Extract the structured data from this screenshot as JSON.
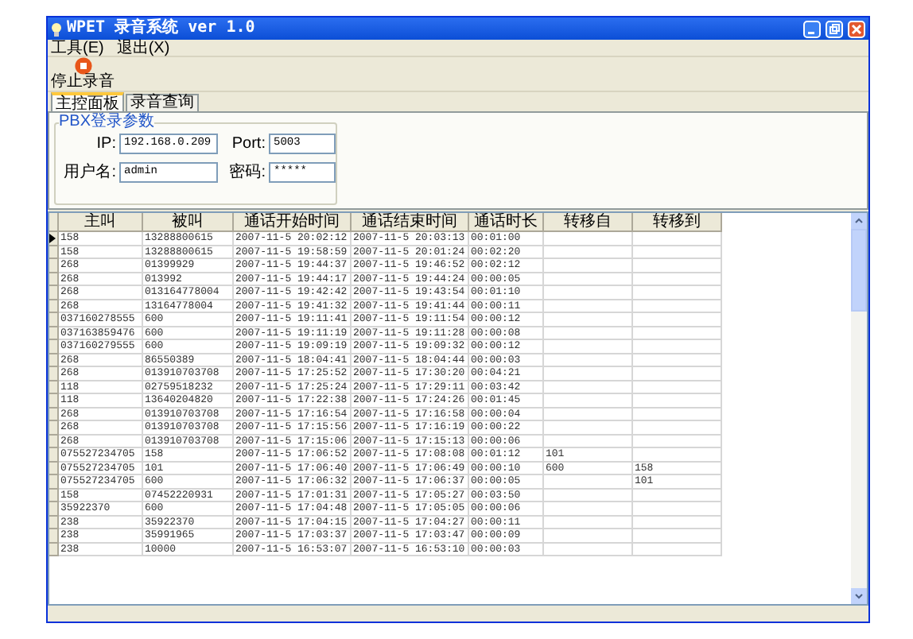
{
  "window": {
    "title": "WPET 录音系统 ver 1.0"
  },
  "menu": [
    "工具(E)",
    "退出(X)"
  ],
  "toolbar": [
    {
      "label": "停止录音"
    }
  ],
  "tabs": [
    {
      "label": "主控面板",
      "selected": true
    },
    {
      "label": "录音查询",
      "selected": false
    }
  ],
  "login_group": {
    "title": "PBX登录参数",
    "fields": [
      {
        "label": "IP:",
        "value": "192.168.0.209"
      },
      {
        "label": "Port:",
        "value": "5003"
      },
      {
        "label": "用户名:",
        "value": "admin"
      },
      {
        "label": "密码:",
        "value": "*****"
      }
    ]
  },
  "table": {
    "columns": [
      "主叫",
      "被叫",
      "通话开始时间",
      "通话结束时间",
      "通话时长",
      "转移自",
      "转移到"
    ],
    "rows": [
      {
        "cells": [
          "158",
          "13288800615",
          "2007-11-5 20:02:12",
          "2007-11-5 20:03:13",
          "00:01:00"
        ],
        "selected": true
      },
      {
        "cells": [
          "158",
          "13288800615",
          "2007-11-5 19:58:59",
          "2007-11-5 20:01:24",
          "00:02:20"
        ],
        "selected": false
      },
      {
        "cells": [
          "268",
          "01399929",
          "2007-11-5 19:44:37",
          "2007-11-5 19:46:52",
          "00:02:12"
        ],
        "selected": false
      },
      {
        "cells": [
          "268",
          "013992",
          "2007-11-5 19:44:17",
          "2007-11-5 19:44:24",
          "00:00:05"
        ],
        "selected": false
      },
      {
        "cells": [
          "268",
          "013164778004",
          "2007-11-5 19:42:42",
          "2007-11-5 19:43:54",
          "00:01:10"
        ],
        "selected": false
      },
      {
        "cells": [
          "268",
          "13164778004",
          "2007-11-5 19:41:32",
          "2007-11-5 19:41:44",
          "00:00:11"
        ],
        "selected": false
      },
      {
        "cells": [
          "037160278555",
          "600",
          "2007-11-5 19:11:41",
          "2007-11-5 19:11:54",
          "00:00:12"
        ],
        "selected": false
      },
      {
        "cells": [
          "037163859476",
          "600",
          "2007-11-5 19:11:19",
          "2007-11-5 19:11:28",
          "00:00:08"
        ],
        "selected": false
      },
      {
        "cells": [
          "037160279555",
          "600",
          "2007-11-5 19:09:19",
          "2007-11-5 19:09:32",
          "00:00:12"
        ],
        "selected": false
      },
      {
        "cells": [
          "268",
          "86550389",
          "2007-11-5 18:04:41",
          "2007-11-5 18:04:44",
          "00:00:03"
        ],
        "selected": false
      },
      {
        "cells": [
          "268",
          "013910703708",
          "2007-11-5 17:25:52",
          "2007-11-5 17:30:20",
          "00:04:21"
        ],
        "selected": false
      },
      {
        "cells": [
          "118",
          "02759518232",
          "2007-11-5 17:25:24",
          "2007-11-5 17:29:11",
          "00:03:42"
        ],
        "selected": false
      },
      {
        "cells": [
          "118",
          "13640204820",
          "2007-11-5 17:22:38",
          "2007-11-5 17:24:26",
          "00:01:45"
        ],
        "selected": false
      },
      {
        "cells": [
          "268",
          "013910703708",
          "2007-11-5 17:16:54",
          "2007-11-5 17:16:58",
          "00:00:04"
        ],
        "selected": false
      },
      {
        "cells": [
          "268",
          "013910703708",
          "2007-11-5 17:15:56",
          "2007-11-5 17:16:19",
          "00:00:22"
        ],
        "selected": false
      },
      {
        "cells": [
          "268",
          "013910703708",
          "2007-11-5 17:15:06",
          "2007-11-5 17:15:13",
          "00:00:06"
        ],
        "selected": false
      },
      {
        "cells": [
          "075527234705",
          "158",
          "2007-11-5 17:06:52",
          "2007-11-5 17:08:08",
          "00:01:12",
          "101"
        ],
        "selected": false
      },
      {
        "cells": [
          "075527234705",
          "101",
          "2007-11-5 17:06:40",
          "2007-11-5 17:06:49",
          "00:00:10",
          "600",
          "158"
        ],
        "selected": false
      },
      {
        "cells": [
          "075527234705",
          "600",
          "2007-11-5 17:06:32",
          "2007-11-5 17:06:37",
          "00:00:05",
          null,
          "101"
        ],
        "selected": false
      },
      {
        "cells": [
          "158",
          "07452220931",
          "2007-11-5 17:01:31",
          "2007-11-5 17:05:27",
          "00:03:50"
        ],
        "selected": false
      },
      {
        "cells": [
          "35922370",
          "600",
          "2007-11-5 17:04:48",
          "2007-11-5 17:05:05",
          "00:00:06"
        ],
        "selected": false
      },
      {
        "cells": [
          "238",
          "35922370",
          "2007-11-5 17:04:15",
          "2007-11-5 17:04:27",
          "00:00:11"
        ],
        "selected": false
      },
      {
        "cells": [
          "238",
          "35991965",
          "2007-11-5 17:03:37",
          "2007-11-5 17:03:47",
          "00:00:09"
        ],
        "selected": false
      },
      {
        "cells": [
          "238",
          "10000",
          "2007-11-5 16:53:07",
          "2007-11-5 16:53:10",
          "00:00:03"
        ],
        "selected": false
      }
    ]
  }
}
